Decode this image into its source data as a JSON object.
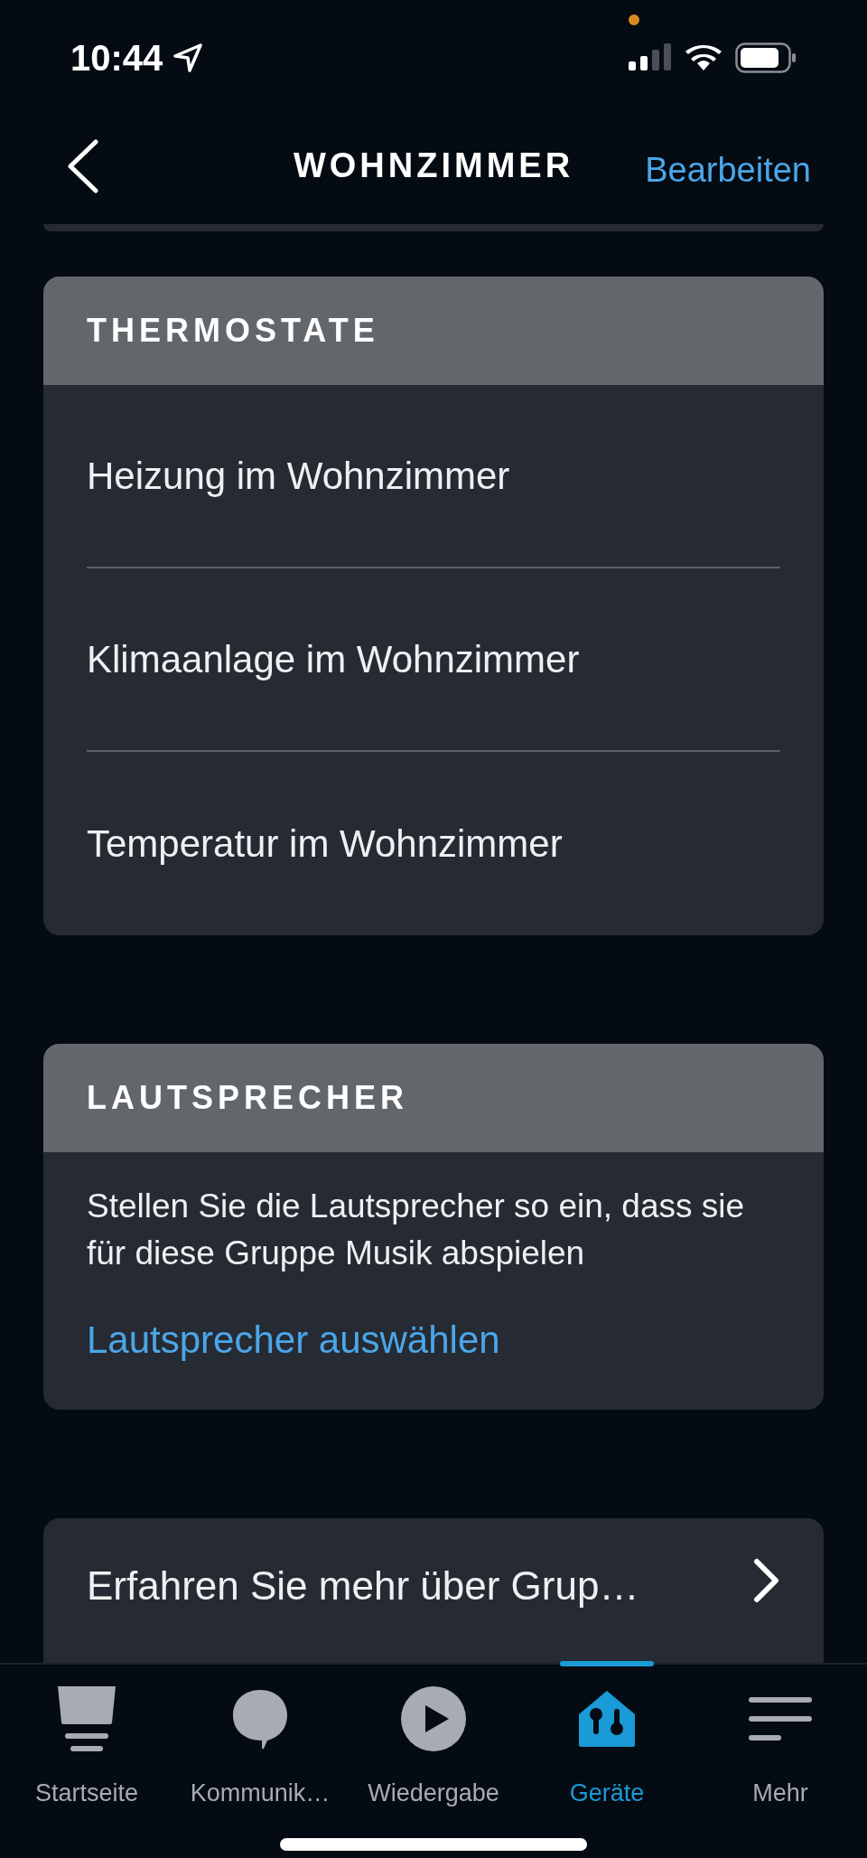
{
  "status_bar": {
    "time": "10:44"
  },
  "header": {
    "title": "WOHNZIMMER",
    "action": "Bearbeiten"
  },
  "sections": [
    {
      "kind": "list",
      "title": "THERMOSTATE",
      "items": [
        "Heizung im Wohnzimmer",
        "Klimaanlage im Wohnzimmer",
        "Temperatur im Wohnzimmer"
      ]
    },
    {
      "kind": "info",
      "title": "LAUTSPRECHER",
      "text": "Stellen Sie die Lautsprecher so ein, dass sie für diese Gruppe Musik abspielen",
      "link": "Lautsprecher auswählen"
    }
  ],
  "learn_more": {
    "label": "Erfahren Sie mehr über Grup…"
  },
  "tab_bar": [
    {
      "kind": "home",
      "label": "Startseite",
      "selected": false
    },
    {
      "kind": "chat",
      "label": "Kommunik…",
      "selected": false
    },
    {
      "kind": "play",
      "label": "Wiedergabe",
      "selected": false
    },
    {
      "kind": "devices",
      "label": "Geräte",
      "selected": true
    },
    {
      "kind": "more",
      "label": "Mehr",
      "selected": false
    }
  ]
}
